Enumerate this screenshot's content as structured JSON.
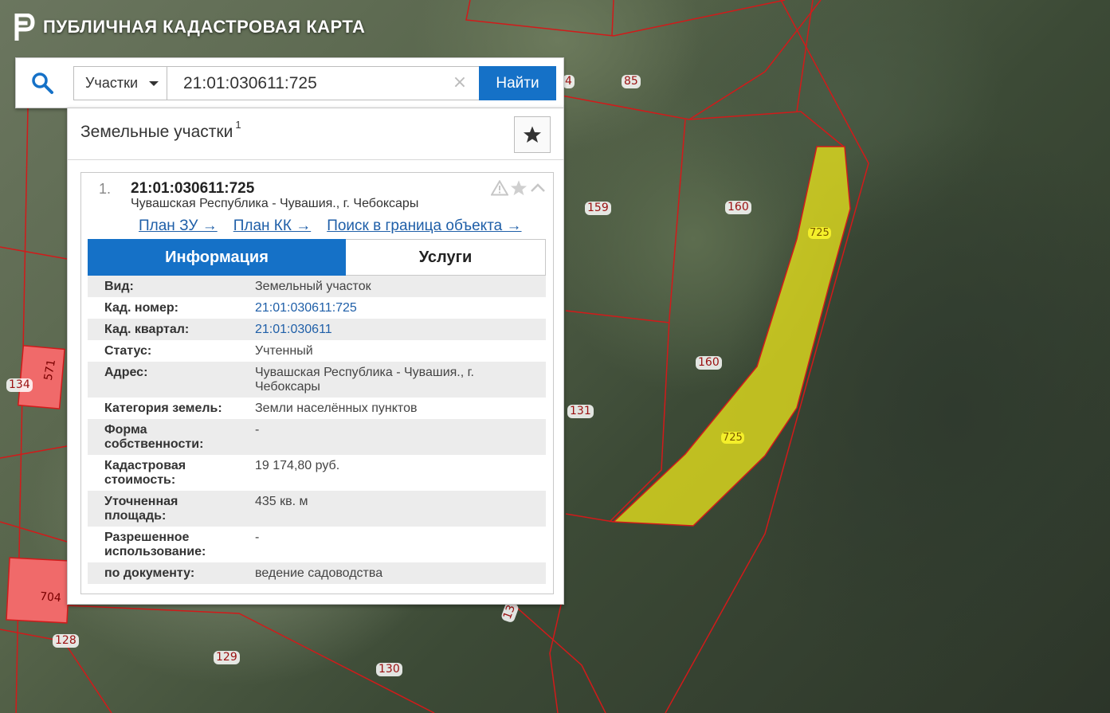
{
  "app": {
    "title": "ПУБЛИЧНАЯ КАДАСТРОВАЯ КАРТА"
  },
  "search": {
    "type_selected": "Участки",
    "query": "21:01:030611:725",
    "clear": "×",
    "submit_label": "Найти"
  },
  "panel": {
    "title": "Земельные участки",
    "count": "1"
  },
  "result": {
    "number": "1.",
    "cadastral_number": "21:01:030611:725",
    "address": "Чувашская Республика - Чувашия., г. Чебоксары",
    "links": [
      {
        "label": "План ЗУ →"
      },
      {
        "label": "План КК →"
      },
      {
        "label": "Поиск в граница объекта →"
      }
    ],
    "tabs": {
      "info": "Информация",
      "services": "Услуги"
    },
    "info": [
      {
        "key": "Вид:",
        "value": "Земельный участок"
      },
      {
        "key": "Кад. номер:",
        "value": "21:01:030611:725"
      },
      {
        "key": "Кад. квартал:",
        "value": "21:01:030611"
      },
      {
        "key": "Статус:",
        "value": "Учтенный"
      },
      {
        "key": "Адрес:",
        "value": "Чувашская Республика - Чувашия., г. Чебоксары"
      },
      {
        "key": "Категория земель:",
        "value": "Земли населённых пунктов"
      },
      {
        "key": "Форма собственности:",
        "value": "-"
      },
      {
        "key": "Кадастровая стоимость:",
        "value": "19 174,80 руб."
      },
      {
        "key": "Уточненная площадь:",
        "value": "435 кв. м"
      },
      {
        "key": "Разрешенное использование:",
        "value": "-"
      },
      {
        "key": "по документу:",
        "value": "ведение садоводства"
      }
    ]
  },
  "map": {
    "parcel_labels": [
      "85",
      "159",
      "160",
      "160",
      "131",
      "134",
      "128",
      "129",
      "130",
      "704",
      "571",
      "4",
      "13"
    ],
    "selected_labels": [
      "725",
      "725"
    ],
    "colors": {
      "boundary": "#d21a1a",
      "selected_fill": "#e6e01c",
      "accent": "#1571c7"
    }
  }
}
